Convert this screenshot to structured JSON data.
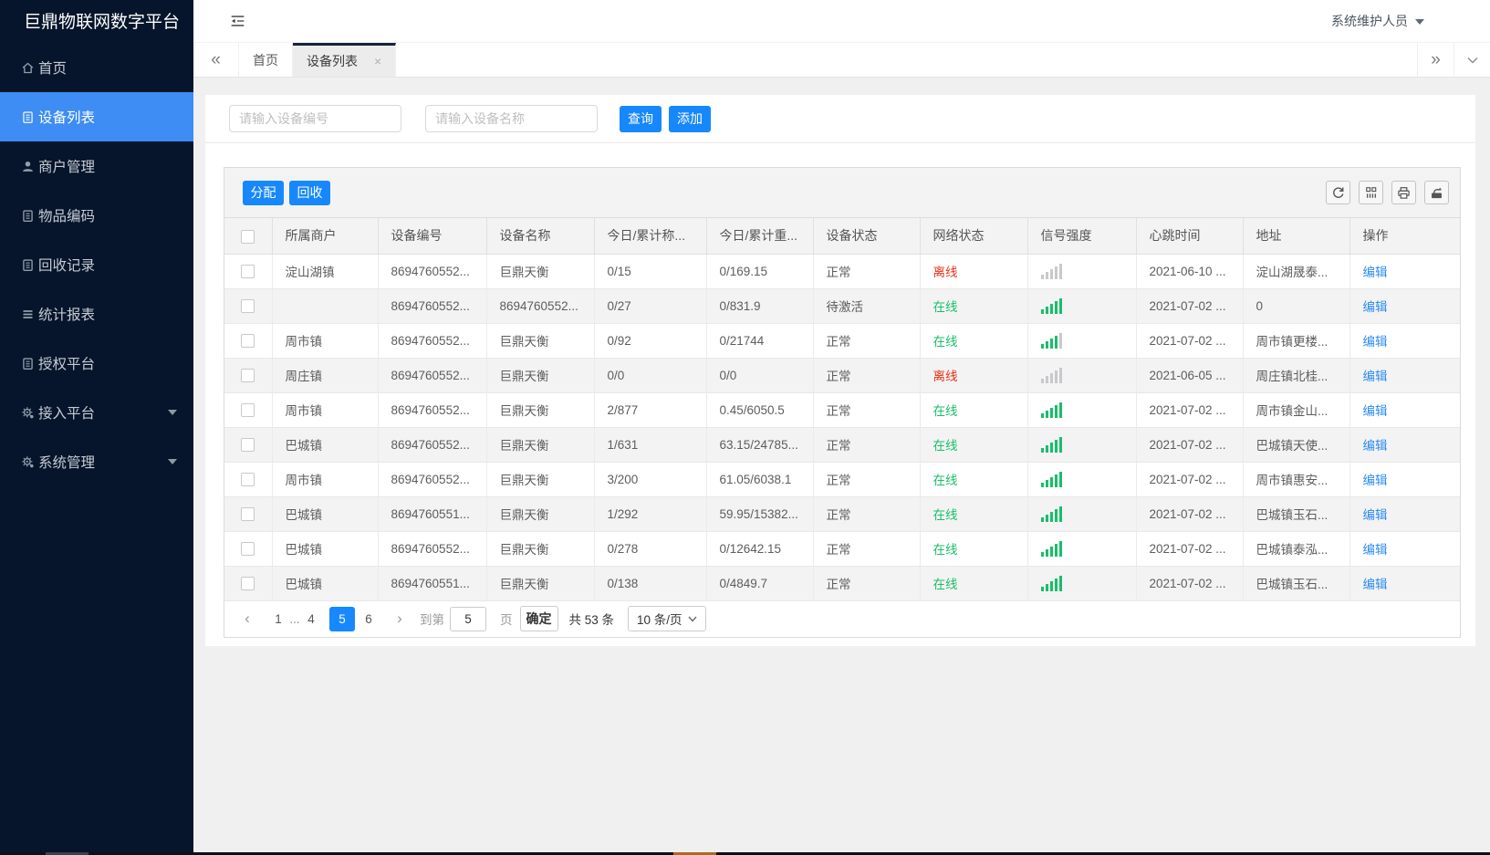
{
  "sidebar": {
    "title": "巨鼎物联网数字平台",
    "items": [
      {
        "id": "home",
        "label": "首页",
        "icon": "home-icon",
        "icon_type": "home",
        "active": false,
        "caret": false
      },
      {
        "id": "devices",
        "label": "设备列表",
        "icon": "list-icon",
        "icon_type": "clipboard",
        "active": true,
        "caret": false
      },
      {
        "id": "merchants",
        "label": "商户管理",
        "icon": "user-icon",
        "icon_type": "user",
        "active": false,
        "caret": false
      },
      {
        "id": "items",
        "label": "物品编码",
        "icon": "clipboard-icon",
        "icon_type": "clipboard",
        "active": false,
        "caret": false
      },
      {
        "id": "recycle",
        "label": "回收记录",
        "icon": "clipboard-icon",
        "icon_type": "clipboard",
        "active": false,
        "caret": false
      },
      {
        "id": "reports",
        "label": "统计报表",
        "icon": "lines-icon",
        "icon_type": "lines",
        "active": false,
        "caret": false
      },
      {
        "id": "authorize",
        "label": "授权平台",
        "icon": "clipboard-icon",
        "icon_type": "clipboard",
        "active": false,
        "caret": false
      },
      {
        "id": "access",
        "label": "接入平台",
        "icon": "gear-icon",
        "icon_type": "gear",
        "active": false,
        "caret": true
      },
      {
        "id": "system",
        "label": "系统管理",
        "icon": "gear-icon",
        "icon_type": "gear",
        "active": false,
        "caret": true
      }
    ]
  },
  "header": {
    "user": "系统维护人员"
  },
  "tabs": [
    {
      "label": "首页",
      "active": false,
      "closable": false
    },
    {
      "label": "设备列表",
      "active": true,
      "closable": true
    }
  ],
  "search": {
    "placeholder_code": "请输入设备编号",
    "placeholder_name": "请输入设备名称",
    "query_label": "查询",
    "add_label": "添加"
  },
  "toolbar": {
    "assign_label": "分配",
    "recycle_label": "回收",
    "icons": [
      "refresh-icon",
      "columns-icon",
      "print-icon",
      "export-icon"
    ]
  },
  "table": {
    "columns": [
      "所属商户",
      "设备编号",
      "设备名称",
      "今日/累计称...",
      "今日/累计重...",
      "设备状态",
      "网络状态",
      "信号强度",
      "心跳时间",
      "地址",
      "操作"
    ],
    "rows": [
      {
        "merchant": "淀山湖镇",
        "code": "8694760552...",
        "name": "巨鼎天衡",
        "today_count": "0/15",
        "today_weight": "0/169.15",
        "device_status": "正常",
        "network": "离线",
        "online": false,
        "signal": 0,
        "heartbeat": "2021-06-10 ...",
        "address": "淀山湖晟泰...",
        "action": "编辑"
      },
      {
        "merchant": "",
        "code": "8694760552...",
        "name": "8694760552...",
        "today_count": "0/27",
        "today_weight": "0/831.9",
        "device_status": "待激活",
        "network": "在线",
        "online": true,
        "signal": 5,
        "heartbeat": "2021-07-02 ...",
        "address": "0",
        "action": "编辑"
      },
      {
        "merchant": "周市镇",
        "code": "8694760552...",
        "name": "巨鼎天衡",
        "today_count": "0/92",
        "today_weight": "0/21744",
        "device_status": "正常",
        "network": "在线",
        "online": true,
        "signal": 4,
        "heartbeat": "2021-07-02 ...",
        "address": "周市镇更楼...",
        "action": "编辑"
      },
      {
        "merchant": "周庄镇",
        "code": "8694760552...",
        "name": "巨鼎天衡",
        "today_count": "0/0",
        "today_weight": "0/0",
        "device_status": "正常",
        "network": "离线",
        "online": false,
        "signal": 0,
        "heartbeat": "2021-06-05 ...",
        "address": "周庄镇北桂...",
        "action": "编辑"
      },
      {
        "merchant": "周市镇",
        "code": "8694760552...",
        "name": "巨鼎天衡",
        "today_count": "2/877",
        "today_weight": "0.45/6050.5",
        "device_status": "正常",
        "network": "在线",
        "online": true,
        "signal": 5,
        "heartbeat": "2021-07-02 ...",
        "address": "周市镇金山...",
        "action": "编辑"
      },
      {
        "merchant": "巴城镇",
        "code": "8694760552...",
        "name": "巨鼎天衡",
        "today_count": "1/631",
        "today_weight": "63.15/24785...",
        "device_status": "正常",
        "network": "在线",
        "online": true,
        "signal": 5,
        "heartbeat": "2021-07-02 ...",
        "address": "巴城镇天使...",
        "action": "编辑"
      },
      {
        "merchant": "周市镇",
        "code": "8694760552...",
        "name": "巨鼎天衡",
        "today_count": "3/200",
        "today_weight": "61.05/6038.1",
        "device_status": "正常",
        "network": "在线",
        "online": true,
        "signal": 5,
        "heartbeat": "2021-07-02 ...",
        "address": "周市镇惠安...",
        "action": "编辑"
      },
      {
        "merchant": "巴城镇",
        "code": "8694760551...",
        "name": "巨鼎天衡",
        "today_count": "1/292",
        "today_weight": "59.95/15382...",
        "device_status": "正常",
        "network": "在线",
        "online": true,
        "signal": 5,
        "heartbeat": "2021-07-02 ...",
        "address": "巴城镇玉石...",
        "action": "编辑"
      },
      {
        "merchant": "巴城镇",
        "code": "8694760552...",
        "name": "巨鼎天衡",
        "today_count": "0/278",
        "today_weight": "0/12642.15",
        "device_status": "正常",
        "network": "在线",
        "online": true,
        "signal": 5,
        "heartbeat": "2021-07-02 ...",
        "address": "巴城镇泰泓...",
        "action": "编辑"
      },
      {
        "merchant": "巴城镇",
        "code": "8694760551...",
        "name": "巨鼎天衡",
        "today_count": "0/138",
        "today_weight": "0/4849.7",
        "device_status": "正常",
        "network": "在线",
        "online": true,
        "signal": 5,
        "heartbeat": "2021-07-02 ...",
        "address": "巴城镇玉石...",
        "action": "编辑"
      }
    ]
  },
  "pagination": {
    "prev": "‹",
    "next": "›",
    "pages": [
      "1",
      "...",
      "4",
      "5",
      "6"
    ],
    "current": "5",
    "goto_label": "到第",
    "goto_value": "5",
    "page_label": "页",
    "confirm_label": "确定",
    "total_label": "共 53 条",
    "page_size": "10 条/页"
  },
  "colors": {
    "accent_blue": "#1788fb",
    "sidebar_active": "#3d8df5",
    "online_green": "#19be6b",
    "offline_red": "#ed2f14",
    "link_blue": "#2d8cf0"
  }
}
